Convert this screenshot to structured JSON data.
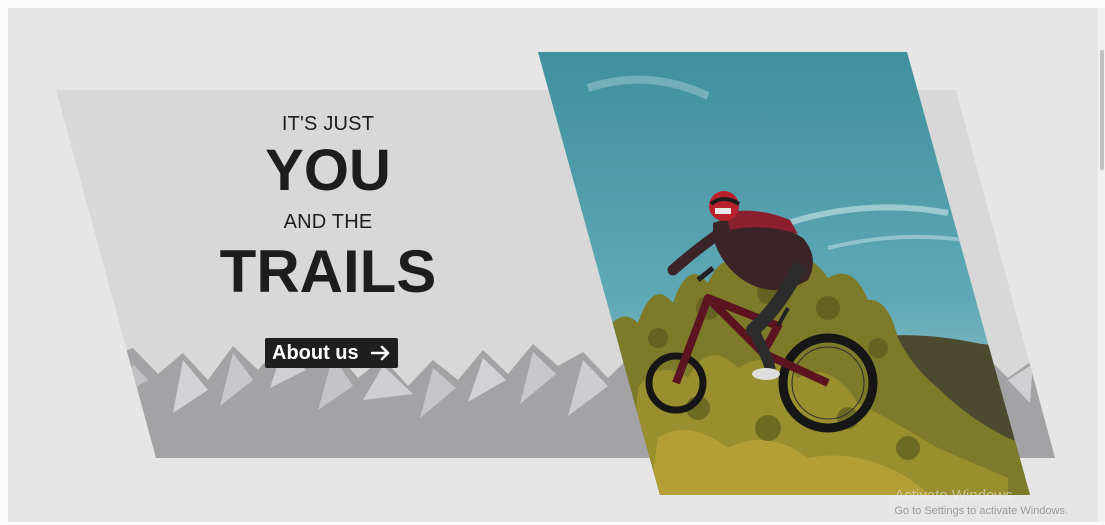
{
  "hero": {
    "line1": "IT'S JUST",
    "line2": "YOU",
    "line3": "AND THE",
    "line4": "TRAILS"
  },
  "cta": {
    "label": "About us",
    "icon": "arrow-right-icon"
  },
  "photo": {
    "subject": "mountain-biker-jumping"
  },
  "watermark": {
    "title": "Activate Windows",
    "subtitle": "Go to Settings to activate Windows."
  },
  "colors": {
    "page_bg": "#e6e6e6",
    "panel": "#d8d8d8",
    "mountains_dark": "#a3a3a5",
    "mountains_light": "#c4c4c6",
    "text": "#1d1d1d",
    "button_bg": "#1f1f1f",
    "sky": "#4a98a8",
    "foliage": "#8a8a2a"
  }
}
